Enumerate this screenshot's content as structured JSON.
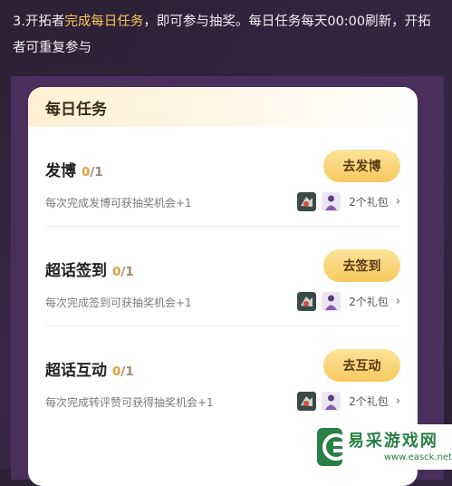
{
  "intro": {
    "prefix": "3.开拓者",
    "highlight": "完成每日任务",
    "suffix": "，即可参与抽奖。每日任务每天00:00刷新，开拓者可重复参与"
  },
  "card": {
    "title": "每日任务",
    "tasks": [
      {
        "name": "发博",
        "progress_current": "0",
        "progress_total": "/1",
        "description": "每次完成发博可获抽奖机会+1",
        "button_label": "去发博",
        "gift_count": "2个礼包"
      },
      {
        "name": "超话签到",
        "progress_current": "0",
        "progress_total": "/1",
        "description": "每次完成签到可获抽奖机会+1",
        "button_label": "去签到",
        "gift_count": "2个礼包"
      },
      {
        "name": "超话互动",
        "progress_current": "0",
        "progress_total": "/1",
        "description": "每次完成转评赞可获得抽奖机会+1",
        "button_label": "去互动",
        "gift_count": "2个礼包"
      }
    ]
  },
  "watermark": {
    "name": "易采游戏网",
    "url": "www.easck.net"
  },
  "colors": {
    "background": "#2e2037",
    "highlight": "#f6c453",
    "button": "#f7c95e",
    "progress": "#e0a23a",
    "watermark": "#2a7f45"
  },
  "icons": [
    "gift-item-icon",
    "gift-character-icon",
    "chevron-right-icon",
    "watermark-logo-icon"
  ]
}
